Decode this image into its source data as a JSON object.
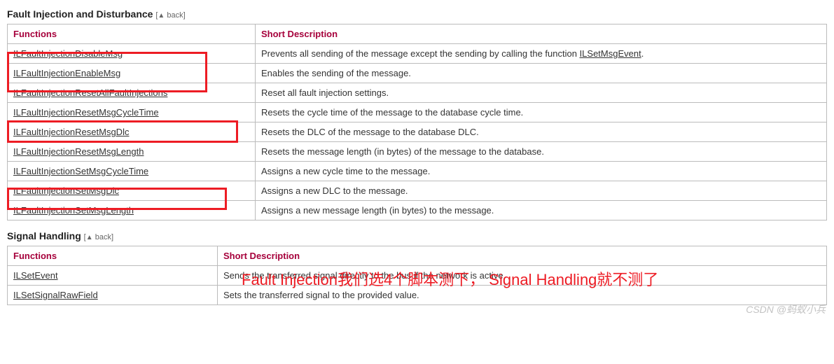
{
  "sections": [
    {
      "title": "Fault Injection and Disturbance",
      "back_label": "back",
      "headers": {
        "fn": "Functions",
        "desc": "Short Description"
      },
      "rows": [
        {
          "fn": "ILFaultInjectionDisableMsg",
          "desc_pre": "Prevents all sending of the message except the sending by calling the function ",
          "desc_link": "ILSetMsgEvent",
          "desc_post": "."
        },
        {
          "fn": "ILFaultInjectionEnableMsg",
          "desc": "Enables the sending of the message."
        },
        {
          "fn": "ILFaultInjectionResetAllFaultInjections",
          "desc": "Reset all fault injection settings."
        },
        {
          "fn": "ILFaultInjectionResetMsgCycleTime",
          "desc": "Resets the cycle time of the message to the database cycle time."
        },
        {
          "fn": "ILFaultInjectionResetMsgDlc",
          "desc": "Resets the DLC of the message to the database DLC."
        },
        {
          "fn": "ILFaultInjectionResetMsgLength",
          "desc": "Resets the message length (in bytes) of the message to the database."
        },
        {
          "fn": "ILFaultInjectionSetMsgCycleTime",
          "desc": "Assigns a new cycle time to the message."
        },
        {
          "fn": "ILFaultInjectionSetMsgDlc",
          "desc": "Assigns a new DLC to the message."
        },
        {
          "fn": "ILFaultInjectionSetMsgLength",
          "desc": "Assigns a new message length (in bytes) to the message."
        }
      ]
    },
    {
      "title": "Signal Handling",
      "back_label": "back",
      "headers": {
        "fn": "Functions",
        "desc": "Short Description"
      },
      "rows": [
        {
          "fn": "ILSetEvent",
          "desc": "Sends the transferred signal directly to the bus if the network is active."
        },
        {
          "fn": "ILSetSignalRawField",
          "desc": "Sets the transferred signal to the provided value."
        }
      ]
    }
  ],
  "annotation": "Fault Injection我们选4个脚本测下，   Signal Handling就不测了",
  "watermark": "CSDN @蚂蚁小兵"
}
